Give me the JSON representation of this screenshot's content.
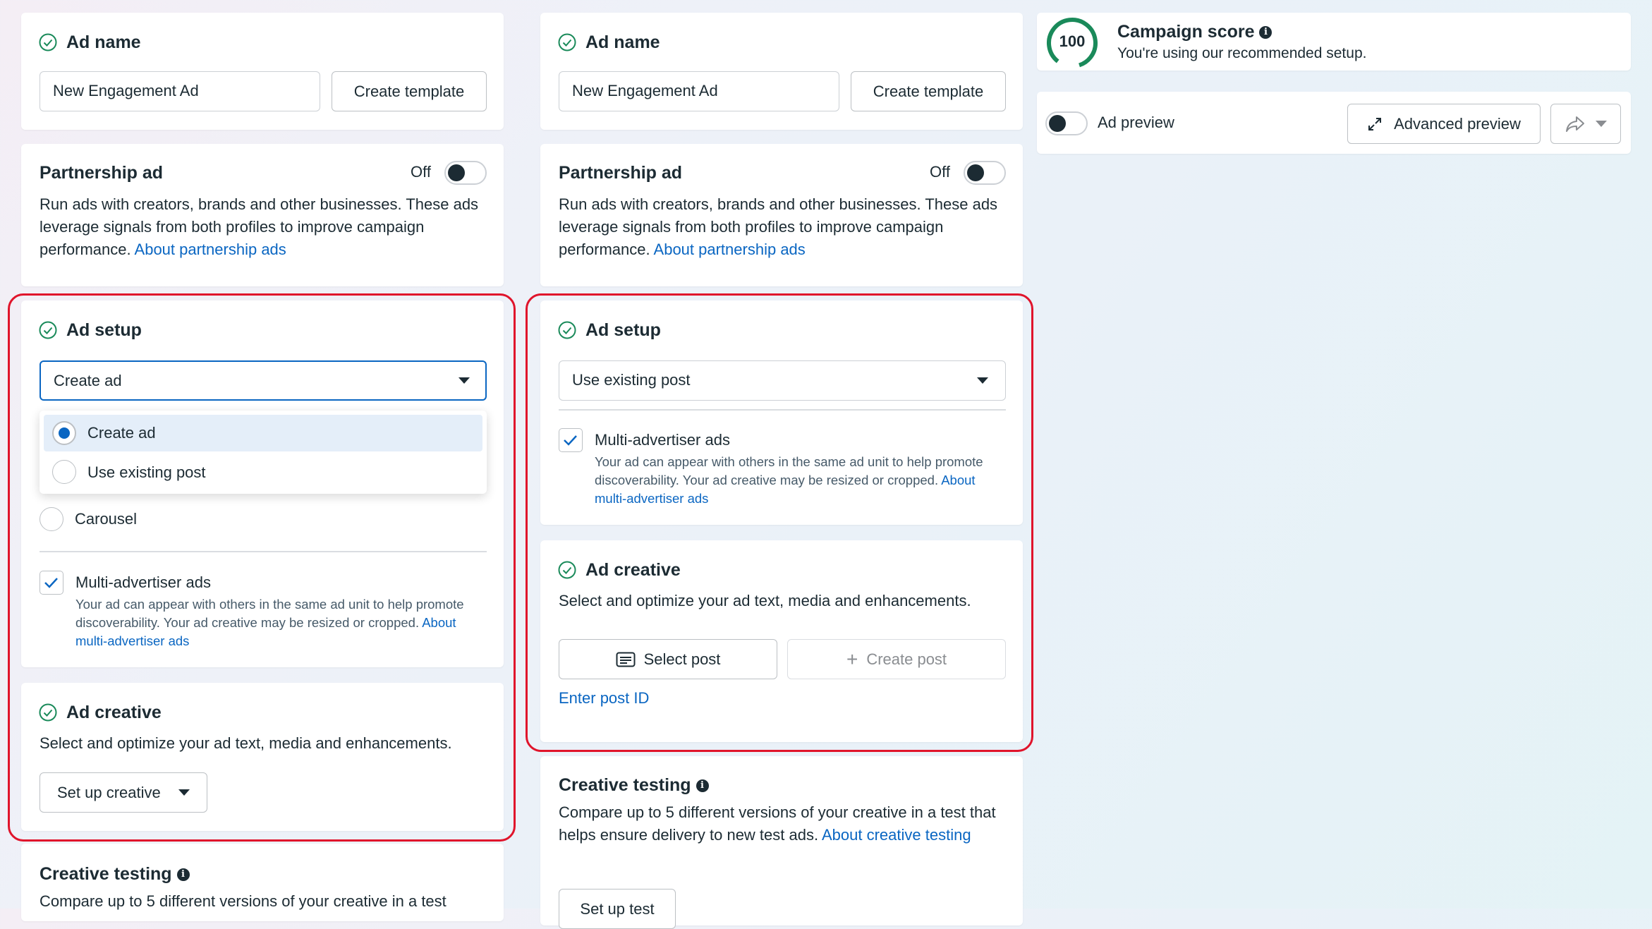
{
  "left": {
    "ad_name": {
      "title": "Ad name",
      "value": "New Engagement Ad",
      "template_button": "Create template"
    },
    "partnership": {
      "title": "Partnership ad",
      "toggle_label": "Off",
      "desc": "Run ads with creators, brands and other businesses. These ads leverage signals from both profiles to improve campaign performance.",
      "link": "About partnership ads"
    },
    "ad_setup": {
      "title": "Ad setup",
      "selected": "Create ad",
      "options": [
        {
          "label": "Create ad",
          "selected": true
        },
        {
          "label": "Use existing post",
          "selected": false
        }
      ],
      "carousel_label": "Carousel",
      "multi": {
        "label": "Multi-advertiser ads",
        "desc": "Your ad can appear with others in the same ad unit to help promote discoverability. Your ad creative may be resized or cropped.",
        "link": "About multi-advertiser ads"
      }
    },
    "ad_creative": {
      "title": "Ad creative",
      "desc": "Select and optimize your ad text, media and enhancements.",
      "button": "Set up creative"
    },
    "creative_testing": {
      "title": "Creative testing",
      "desc": "Compare up to 5 different versions of your creative in a test"
    }
  },
  "middle": {
    "ad_name": {
      "title": "Ad name",
      "value": "New Engagement Ad",
      "template_button": "Create template"
    },
    "partnership": {
      "title": "Partnership ad",
      "toggle_label": "Off",
      "desc": "Run ads with creators, brands and other businesses. These ads leverage signals from both profiles to improve campaign performance.",
      "link": "About partnership ads"
    },
    "ad_setup": {
      "title": "Ad setup",
      "selected": "Use existing post",
      "multi": {
        "label": "Multi-advertiser ads",
        "desc": "Your ad can appear with others in the same ad unit to help promote discoverability. Your ad creative may be resized or cropped.",
        "link": "About multi-advertiser ads"
      }
    },
    "ad_creative": {
      "title": "Ad creative",
      "desc": "Select and optimize your ad text, media and enhancements.",
      "select_post": "Select post",
      "create_post": "Create post",
      "enter_post_id": "Enter post ID"
    },
    "creative_testing": {
      "title": "Creative testing",
      "desc": "Compare up to 5 different versions of your creative in a test that helps ensure delivery to new test ads.",
      "link": "About creative testing",
      "button": "Set up test"
    }
  },
  "right": {
    "score": {
      "value": "100",
      "title": "Campaign score",
      "subtitle": "You're using our recommended setup."
    },
    "preview": {
      "label": "Ad preview",
      "advanced": "Advanced preview"
    }
  },
  "colors": {
    "accent": "#0a66c2",
    "success": "#1a8a5a",
    "highlight": "#e0142b"
  }
}
